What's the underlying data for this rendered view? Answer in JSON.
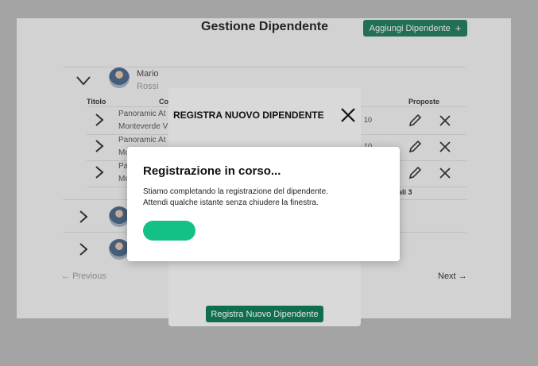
{
  "page": {
    "title": "Gestione Dipendente",
    "add_button_label": "Aggiungi Dipendente",
    "add_button_icon": "plus-icon",
    "accent_color": "#0e6e4e"
  },
  "employees": [
    {
      "first_name": "Mario",
      "last_name": "Rossi",
      "expanded": true
    }
  ],
  "table": {
    "headers": [
      "Titolo",
      "Co",
      "Proposte"
    ],
    "rows": [
      {
        "title": "Panoramic At",
        "subtitle": "Monteverde V",
        "num": "10"
      },
      {
        "title": "Panoramic At",
        "subtitle": "Mo",
        "num": "10"
      },
      {
        "title": "Pa",
        "subtitle": "Mo",
        "num": ""
      }
    ],
    "totals_label": "ali 3"
  },
  "pagination": {
    "previous_label": "Previous",
    "next_label": "Next"
  },
  "modal": {
    "title": "REGISTRA NUOVO DIPENDENTE",
    "submit_label": "Registra Nuovo Dipendente"
  },
  "dialog": {
    "title": "Registrazione in corso...",
    "line1": "Stiamo completando la registrazione del dipendente.",
    "line2": "Attendi qualche istante senza chiudere la finestra.",
    "button_color": "#13c187"
  }
}
